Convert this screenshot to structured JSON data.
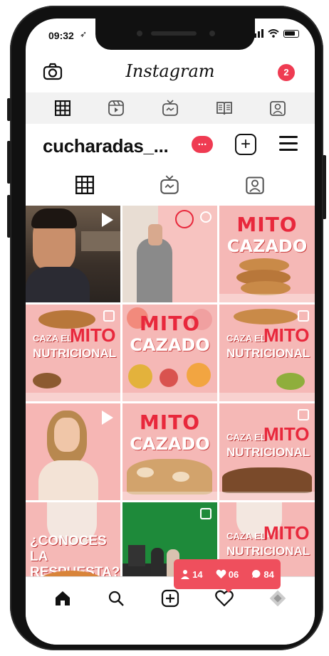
{
  "status_bar": {
    "time": "09:32",
    "location_arrow": "navigation-arrow-icon"
  },
  "app": {
    "title": "Instagram",
    "notification_count": "2"
  },
  "profile": {
    "username": "cucharadas_...",
    "more_label": "..."
  },
  "posts": [
    {
      "type": "video"
    },
    {
      "type": "igtv"
    },
    {
      "title_1": "MITO",
      "title_2": "CAZADO"
    },
    {
      "line_1": "CAZA EL",
      "line_2": "MITO",
      "line_3": "NUTRICIONAL"
    },
    {
      "title_1": "MITO",
      "title_2": "CAZADO"
    },
    {
      "line_1": "CAZA EL",
      "line_2": "MITO",
      "line_3": "NUTRICIONAL"
    },
    {
      "type": "video"
    },
    {
      "title_1": "MITO",
      "title_2": "CAZADO"
    },
    {
      "line_1": "CAZA EL",
      "line_2": "MITO",
      "line_3": "NUTRICIONAL"
    },
    {
      "line_1": "¿CONOCES",
      "line_2": "LA RESPUESTA?"
    },
    {
      "type": "photo"
    },
    {
      "line_1": "CAZA EL",
      "line_2": "MITO",
      "line_3": "NUTRICIONAL"
    }
  ],
  "activity": {
    "followers": "14",
    "likes": "06",
    "comments": "84"
  },
  "colors": {
    "accent": "#ef3b52",
    "tile_pink": "#f5b8b6"
  }
}
